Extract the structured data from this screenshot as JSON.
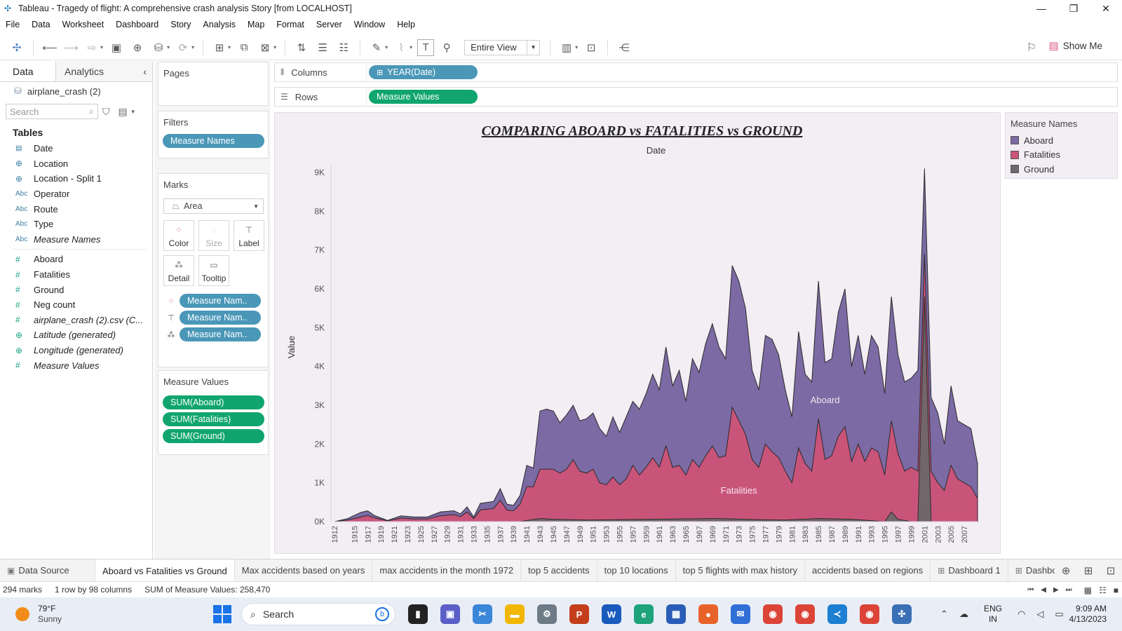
{
  "window": {
    "title": "Tableau - Tragedy of flight: A comprehensive crash analysis Story [from LOCALHOST]",
    "minimize": "—",
    "restore": "❐",
    "close": "✕"
  },
  "menu": [
    "File",
    "Data",
    "Worksheet",
    "Dashboard",
    "Story",
    "Analysis",
    "Map",
    "Format",
    "Server",
    "Window",
    "Help"
  ],
  "toolbar": {
    "view_select": "Entire View",
    "show_me": "Show Me"
  },
  "data_pane": {
    "tab_data": "Data",
    "tab_analytics": "Analytics",
    "collapse": "‹",
    "datasource": "airplane_crash (2)",
    "search_placeholder": "Search",
    "tables_title": "Tables",
    "dimensions": [
      {
        "label": "Date",
        "icon": "▤",
        "kind": "date"
      },
      {
        "label": "Location",
        "icon": "⊕",
        "kind": "geo"
      },
      {
        "label": "Location - Split 1",
        "icon": "⊕",
        "kind": "geo"
      },
      {
        "label": "Operator",
        "icon": "Abc",
        "kind": "text"
      },
      {
        "label": "Route",
        "icon": "Abc",
        "kind": "text"
      },
      {
        "label": "Type",
        "icon": "Abc",
        "kind": "text"
      },
      {
        "label": "Measure Names",
        "icon": "Abc",
        "kind": "text",
        "italic": true
      }
    ],
    "measures": [
      {
        "label": "Aboard",
        "icon": "#"
      },
      {
        "label": "Fatalities",
        "icon": "#"
      },
      {
        "label": "Ground",
        "icon": "#"
      },
      {
        "label": "Neg count",
        "icon": "#"
      },
      {
        "label": "airplane_crash (2).csv (C...",
        "icon": "#",
        "italic": true
      },
      {
        "label": "Latitude (generated)",
        "icon": "⊕",
        "italic": true
      },
      {
        "label": "Longitude (generated)",
        "icon": "⊕",
        "italic": true
      },
      {
        "label": "Measure Values",
        "icon": "#",
        "italic": true
      }
    ]
  },
  "cards": {
    "pages_title": "Pages",
    "filters_title": "Filters",
    "filters_pill": "Measure Names",
    "marks_title": "Marks",
    "mark_type": "Area",
    "mark_buttons": [
      "Color",
      "Size",
      "Label",
      "Detail",
      "Tooltip"
    ],
    "mark_pills": [
      "Measure Nam..",
      "Measure Nam..",
      "Measure Nam.."
    ],
    "measure_values_title": "Measure Values",
    "measure_values_pills": [
      "SUM(Aboard)",
      "SUM(Fatalities)",
      "SUM(Ground)"
    ]
  },
  "shelves": {
    "columns_label": "Columns",
    "columns_pill": "YEAR(Date)",
    "rows_label": "Rows",
    "rows_pill": "Measure Values"
  },
  "legend": {
    "title": "Measure Names",
    "items": [
      {
        "label": "Aboard",
        "color": "#7b6aa3"
      },
      {
        "label": "Fatalities",
        "color": "#c9547a"
      },
      {
        "label": "Ground",
        "color": "#6f6769"
      }
    ]
  },
  "chart_data": {
    "type": "area",
    "title": "COMPARING ABOARD vs FATALITIES vs GROUND",
    "xlabel": "Date",
    "ylabel": "Value",
    "ylim": [
      0,
      9000
    ],
    "yticks": [
      "0K",
      "1K",
      "2K",
      "3K",
      "4K",
      "5K",
      "6K",
      "7K",
      "8K",
      "9K"
    ],
    "x_tick_labels": [
      "1912",
      "1915",
      "1917",
      "1919",
      "1921",
      "1923",
      "1925",
      "1927",
      "1929",
      "1931",
      "1933",
      "1935",
      "1937",
      "1939",
      "1941",
      "1943",
      "1945",
      "1947",
      "1949",
      "1951",
      "1953",
      "1955",
      "1957",
      "1959",
      "1961",
      "1963",
      "1965",
      "1967",
      "1969",
      "1971",
      "1973",
      "1975",
      "1977",
      "1979",
      "1981",
      "1983",
      "1985",
      "1987",
      "1989",
      "1991",
      "1993",
      "1995",
      "1997",
      "1999",
      "2001",
      "2003",
      "2005",
      "2007"
    ],
    "series_labels": {
      "Aboard": "Aboard",
      "Fatalities": "Fatalities"
    },
    "series": [
      {
        "name": "Aboard",
        "color": "#7b6aa3",
        "points": [
          [
            1912,
            0
          ],
          [
            1914,
            80
          ],
          [
            1916,
            240
          ],
          [
            1917,
            280
          ],
          [
            1918,
            160
          ],
          [
            1920,
            30
          ],
          [
            1922,
            150
          ],
          [
            1924,
            120
          ],
          [
            1926,
            120
          ],
          [
            1928,
            250
          ],
          [
            1930,
            280
          ],
          [
            1931,
            200
          ],
          [
            1932,
            380
          ],
          [
            1933,
            120
          ],
          [
            1934,
            470
          ],
          [
            1936,
            520
          ],
          [
            1937,
            850
          ],
          [
            1938,
            450
          ],
          [
            1939,
            420
          ],
          [
            1940,
            680
          ],
          [
            1941,
            1450
          ],
          [
            1942,
            1380
          ],
          [
            1943,
            2850
          ],
          [
            1944,
            2900
          ],
          [
            1945,
            2850
          ],
          [
            1946,
            2550
          ],
          [
            1947,
            2750
          ],
          [
            1948,
            3000
          ],
          [
            1949,
            2600
          ],
          [
            1950,
            2650
          ],
          [
            1951,
            2800
          ],
          [
            1952,
            2400
          ],
          [
            1953,
            2200
          ],
          [
            1954,
            2700
          ],
          [
            1955,
            2300
          ],
          [
            1956,
            2700
          ],
          [
            1957,
            3100
          ],
          [
            1958,
            2900
          ],
          [
            1959,
            3300
          ],
          [
            1960,
            3800
          ],
          [
            1961,
            3400
          ],
          [
            1962,
            4500
          ],
          [
            1963,
            3500
          ],
          [
            1964,
            3900
          ],
          [
            1965,
            3100
          ],
          [
            1966,
            4200
          ],
          [
            1967,
            3850
          ],
          [
            1968,
            4600
          ],
          [
            1969,
            5100
          ],
          [
            1970,
            4500
          ],
          [
            1971,
            4200
          ],
          [
            1972,
            6600
          ],
          [
            1973,
            6200
          ],
          [
            1974,
            5500
          ],
          [
            1975,
            3900
          ],
          [
            1976,
            3400
          ],
          [
            1977,
            4800
          ],
          [
            1978,
            4700
          ],
          [
            1979,
            4300
          ],
          [
            1980,
            3400
          ],
          [
            1981,
            2700
          ],
          [
            1982,
            4900
          ],
          [
            1983,
            3800
          ],
          [
            1984,
            3600
          ],
          [
            1985,
            6200
          ],
          [
            1986,
            4100
          ],
          [
            1987,
            4200
          ],
          [
            1988,
            5400
          ],
          [
            1989,
            6000
          ],
          [
            1990,
            4000
          ],
          [
            1991,
            4800
          ],
          [
            1992,
            3800
          ],
          [
            1993,
            4800
          ],
          [
            1994,
            4500
          ],
          [
            1995,
            3300
          ],
          [
            1996,
            5800
          ],
          [
            1997,
            4300
          ],
          [
            1998,
            3600
          ],
          [
            1999,
            3700
          ],
          [
            2000,
            3900
          ],
          [
            2001,
            9100
          ],
          [
            2002,
            3200
          ],
          [
            2003,
            2800
          ],
          [
            2004,
            2000
          ],
          [
            2005,
            3500
          ],
          [
            2006,
            2600
          ],
          [
            2007,
            2500
          ],
          [
            2008,
            2400
          ],
          [
            2009,
            1500
          ]
        ]
      },
      {
        "name": "Fatalities",
        "color": "#c9547a",
        "points": [
          [
            1912,
            0
          ],
          [
            1914,
            40
          ],
          [
            1916,
            120
          ],
          [
            1917,
            160
          ],
          [
            1918,
            100
          ],
          [
            1920,
            20
          ],
          [
            1922,
            90
          ],
          [
            1924,
            70
          ],
          [
            1926,
            70
          ],
          [
            1928,
            150
          ],
          [
            1930,
            180
          ],
          [
            1931,
            130
          ],
          [
            1932,
            250
          ],
          [
            1933,
            80
          ],
          [
            1934,
            300
          ],
          [
            1936,
            340
          ],
          [
            1937,
            550
          ],
          [
            1938,
            300
          ],
          [
            1939,
            280
          ],
          [
            1940,
            450
          ],
          [
            1941,
            900
          ],
          [
            1942,
            900
          ],
          [
            1943,
            1350
          ],
          [
            1944,
            1350
          ],
          [
            1945,
            1350
          ],
          [
            1946,
            1250
          ],
          [
            1947,
            1350
          ],
          [
            1948,
            1600
          ],
          [
            1949,
            1300
          ],
          [
            1950,
            1250
          ],
          [
            1951,
            1350
          ],
          [
            1952,
            1000
          ],
          [
            1953,
            950
          ],
          [
            1954,
            1150
          ],
          [
            1955,
            950
          ],
          [
            1956,
            1100
          ],
          [
            1957,
            1450
          ],
          [
            1958,
            1200
          ],
          [
            1959,
            1400
          ],
          [
            1960,
            1650
          ],
          [
            1961,
            1400
          ],
          [
            1962,
            1950
          ],
          [
            1963,
            1400
          ],
          [
            1964,
            1450
          ],
          [
            1965,
            1200
          ],
          [
            1966,
            1600
          ],
          [
            1967,
            1400
          ],
          [
            1968,
            1700
          ],
          [
            1969,
            1950
          ],
          [
            1970,
            1650
          ],
          [
            1971,
            1700
          ],
          [
            1972,
            2950
          ],
          [
            1973,
            2600
          ],
          [
            1974,
            2250
          ],
          [
            1975,
            1600
          ],
          [
            1976,
            1400
          ],
          [
            1977,
            2000
          ],
          [
            1978,
            1800
          ],
          [
            1979,
            1650
          ],
          [
            1980,
            1300
          ],
          [
            1981,
            1000
          ],
          [
            1982,
            1900
          ],
          [
            1983,
            1500
          ],
          [
            1984,
            1300
          ],
          [
            1985,
            2650
          ],
          [
            1986,
            1600
          ],
          [
            1987,
            1700
          ],
          [
            1988,
            2200
          ],
          [
            1989,
            2450
          ],
          [
            1990,
            1550
          ],
          [
            1991,
            2000
          ],
          [
            1992,
            1550
          ],
          [
            1993,
            1900
          ],
          [
            1994,
            1800
          ],
          [
            1995,
            1200
          ],
          [
            1996,
            2600
          ],
          [
            1997,
            1750
          ],
          [
            1998,
            1300
          ],
          [
            1999,
            1400
          ],
          [
            2000,
            1300
          ],
          [
            2001,
            6900
          ],
          [
            2002,
            1300
          ],
          [
            2003,
            1000
          ],
          [
            2004,
            800
          ],
          [
            2005,
            1450
          ],
          [
            2006,
            1100
          ],
          [
            2007,
            1000
          ],
          [
            2008,
            900
          ],
          [
            2009,
            600
          ]
        ]
      },
      {
        "name": "Ground",
        "color": "#6f6769",
        "points": [
          [
            1912,
            0
          ],
          [
            1940,
            0
          ],
          [
            1943,
            80
          ],
          [
            1945,
            60
          ],
          [
            1950,
            40
          ],
          [
            1960,
            60
          ],
          [
            1970,
            80
          ],
          [
            1976,
            50
          ],
          [
            1980,
            40
          ],
          [
            1985,
            80
          ],
          [
            1990,
            60
          ],
          [
            1995,
            0
          ],
          [
            1996,
            250
          ],
          [
            1997,
            60
          ],
          [
            1999,
            0
          ],
          [
            2000,
            0
          ],
          [
            2001,
            5800
          ],
          [
            2002,
            0
          ],
          [
            2009,
            0
          ]
        ]
      }
    ]
  },
  "sheet_tabs": [
    {
      "label": "Data Source",
      "icon": "▣"
    },
    {
      "label": "Aboard vs Fatalities vs Ground",
      "active": true
    },
    {
      "label": "Max accidents based on years"
    },
    {
      "label": "max accidents in the month 1972"
    },
    {
      "label": "top 5 accidents"
    },
    {
      "label": "top 10 locations"
    },
    {
      "label": "top 5 flights with max history"
    },
    {
      "label": "accidents based on regions"
    },
    {
      "label": "Dashboard 1",
      "icon": "⊞"
    },
    {
      "label": "Dashboar",
      "icon": "⊞"
    }
  ],
  "status": {
    "marks": "294 marks",
    "rows_cols": "1 row by 98 columns",
    "sum": "SUM of Measure Values: 258,470"
  },
  "taskbar": {
    "temp": "79°F",
    "condition": "Sunny",
    "search": "Search",
    "lang1": "ENG",
    "lang2": "IN",
    "time": "9:09 AM",
    "date": "4/13/2023"
  }
}
